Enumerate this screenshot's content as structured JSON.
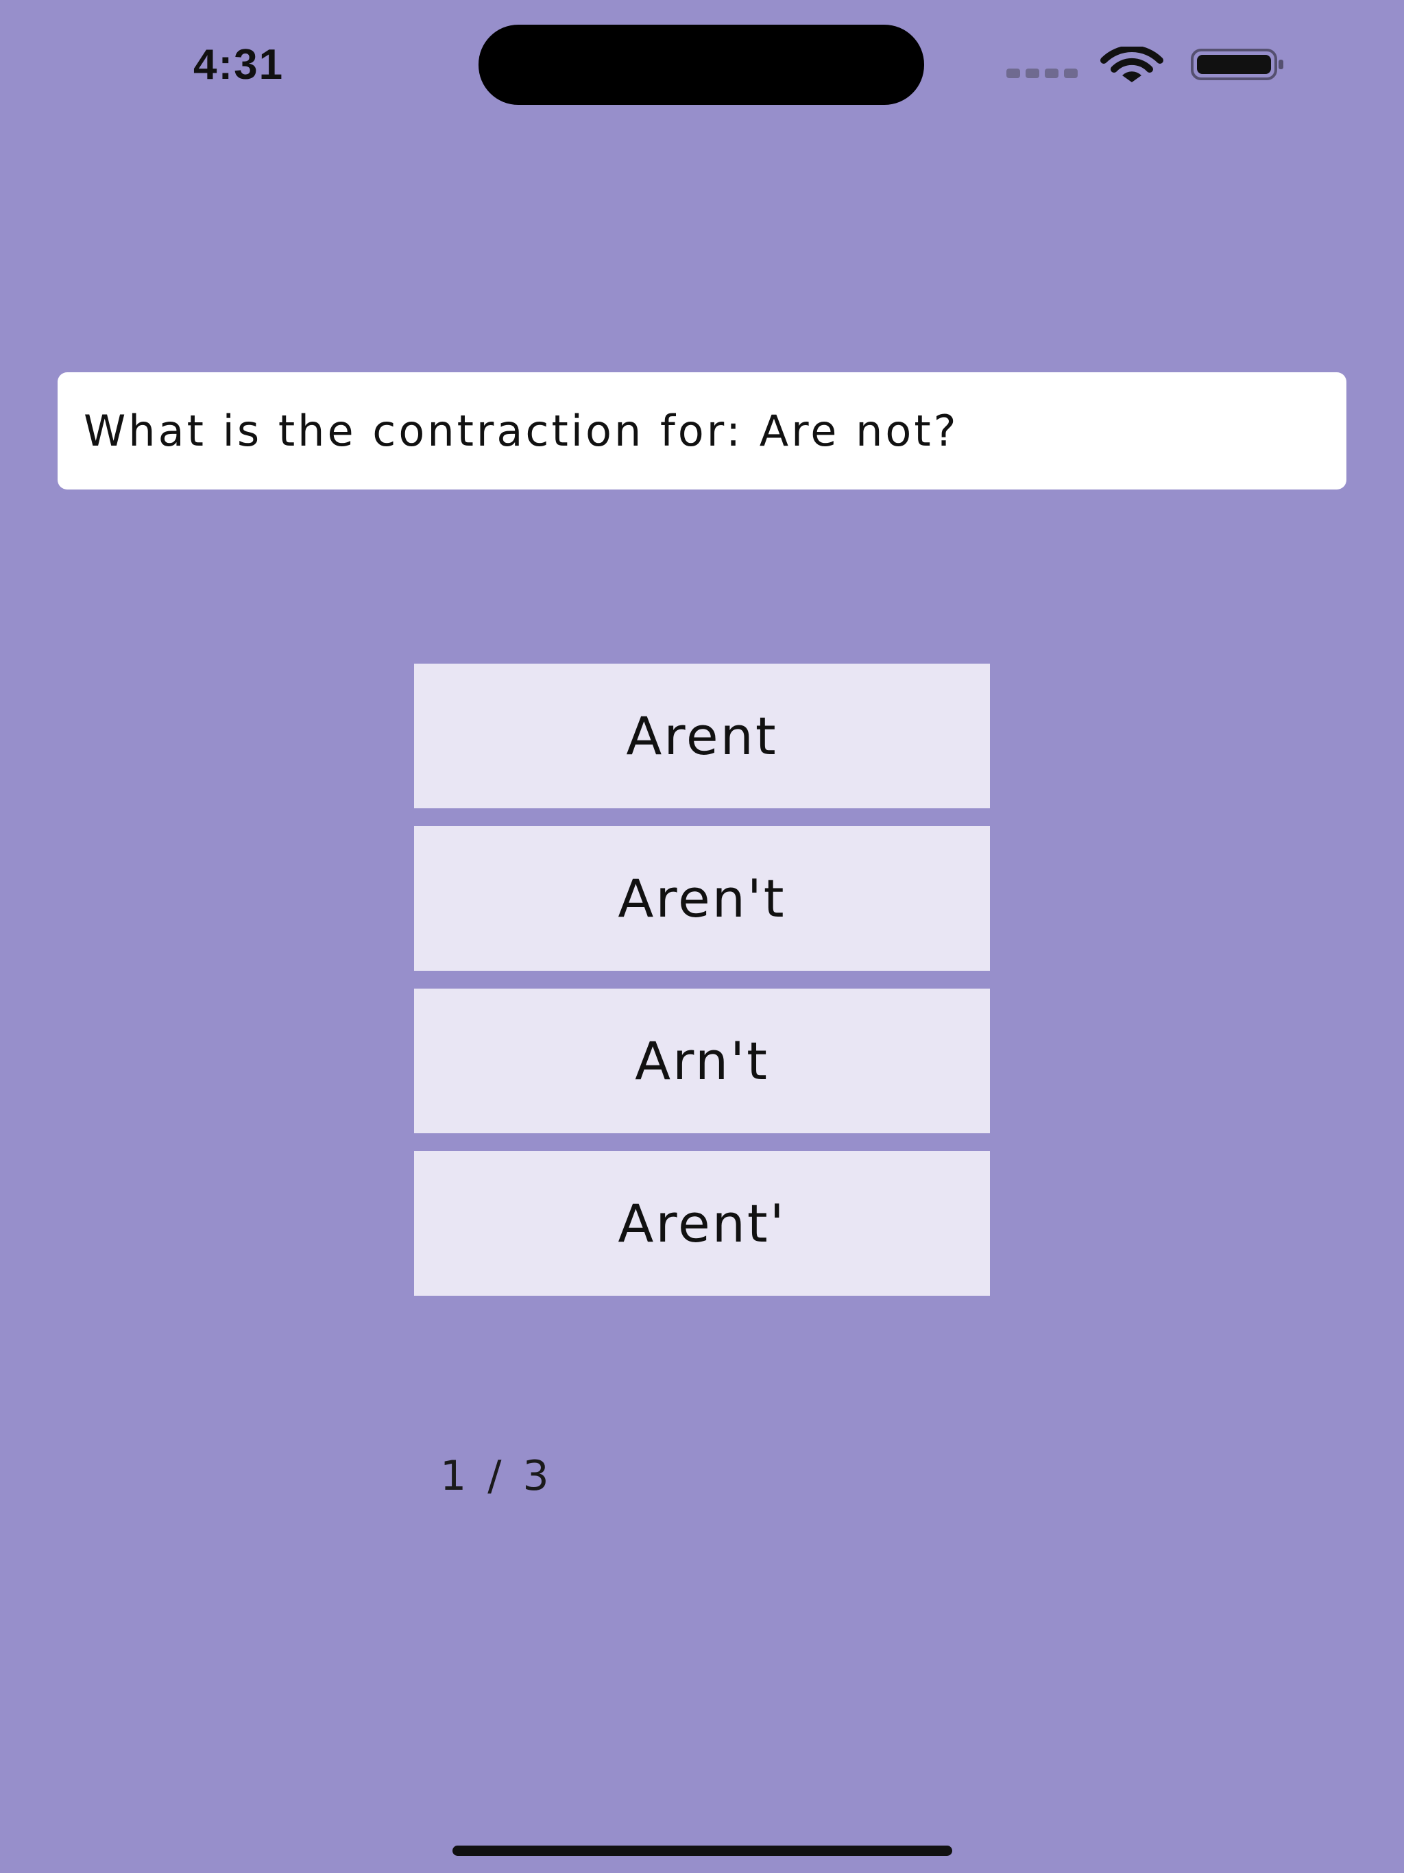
{
  "status_bar": {
    "time": "4:31",
    "icons": [
      "cellular-signal-icon",
      "wifi-icon",
      "battery-icon"
    ]
  },
  "quiz": {
    "question": "What is the contraction for: Are not?",
    "answers": [
      {
        "label": "Arent"
      },
      {
        "label": "Aren't"
      },
      {
        "label": "Arn't"
      },
      {
        "label": "Arent'"
      }
    ],
    "progress": "1 / 3"
  },
  "colors": {
    "background": "#978fcb",
    "card": "#ffffff",
    "button": "#e9e6f4",
    "text": "#111111"
  }
}
